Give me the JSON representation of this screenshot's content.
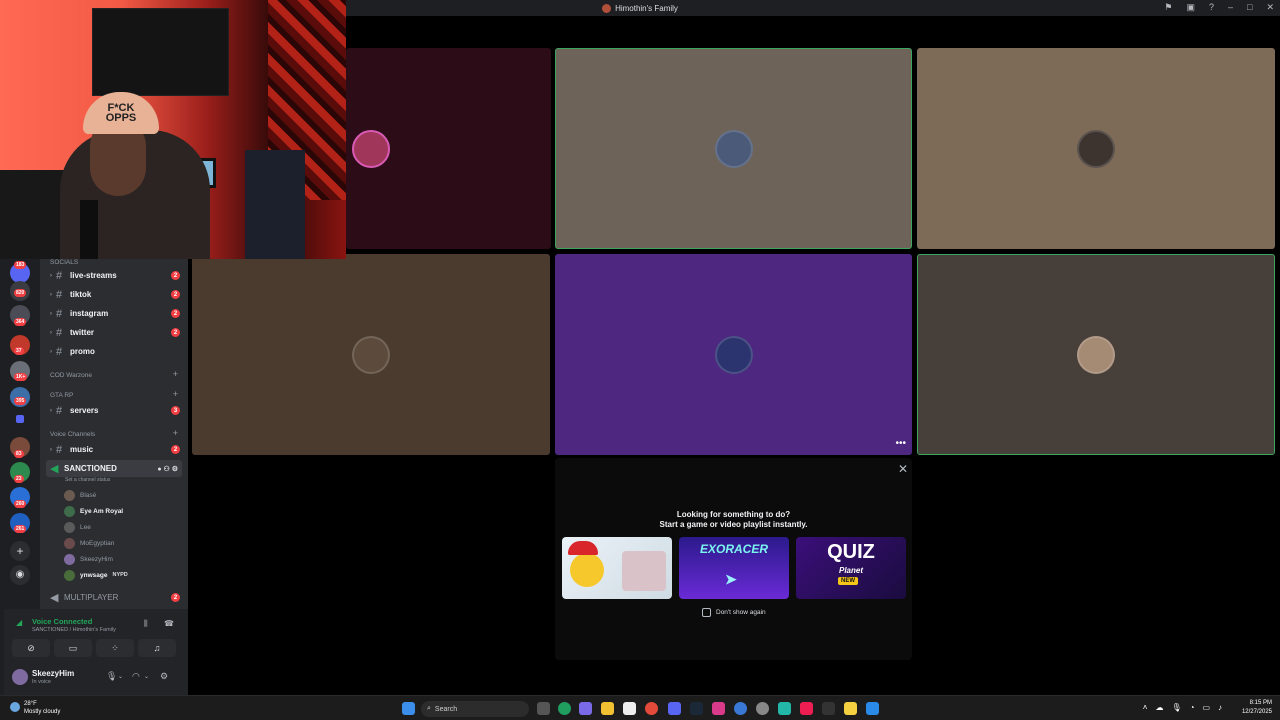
{
  "window": {
    "title": "Himothin's Family"
  },
  "channels": {
    "categories": [
      {
        "label": "SOCIALS",
        "top": 0
      },
      {
        "label": "COD Warzone"
      },
      {
        "label": "GTA RP"
      },
      {
        "label": "Voice Channels"
      }
    ],
    "text_channels": [
      {
        "name": "live-streams",
        "badge": "2"
      },
      {
        "name": "tiktok",
        "badge": "2"
      },
      {
        "name": "instagram",
        "badge": "2"
      },
      {
        "name": "twitter",
        "badge": "2"
      },
      {
        "name": "promo",
        "badge": ""
      },
      {
        "name": "servers",
        "badge": "3"
      },
      {
        "name": "music",
        "badge": "2"
      }
    ],
    "voice_channel": {
      "name": "SANCTIONED",
      "status": "Set a channel status"
    },
    "voice_users": [
      "Blasé",
      "Eye Am Royal",
      "Lee",
      "MoEgyptian",
      "SkeezyHim",
      "ynwsage"
    ],
    "voice_user_tag": "NYPD",
    "multiplayer": {
      "name": "MULTIPLAYER",
      "badge": "2"
    }
  },
  "rail_badges": [
    "183",
    "820",
    "364",
    "37",
    "1K+",
    "395",
    "83",
    "23",
    "260",
    "261"
  ],
  "voice_panel": {
    "status": "Voice Connected",
    "sub": "SANCTIONED / Himothin's Family"
  },
  "user": {
    "name": "SkeezyHim",
    "status": "In voice"
  },
  "activity": {
    "title": "Looking for something to do?",
    "subtitle": "Start a game or video playlist instantly.",
    "games": [
      {
        "name": "",
        "bg": "#e8eef3"
      },
      {
        "name": "EXORACER",
        "bg": "#4a1aa8"
      },
      {
        "name": "QUIZ",
        "sub": "Planet",
        "tag": "NEW",
        "bg": "#2a0d5a"
      }
    ],
    "dont_show": "Don't show again"
  },
  "taskbar": {
    "weather_temp": "28°F",
    "weather_desc": "Mostly cloudy",
    "search_placeholder": "Search",
    "time": "8:15 PM",
    "date": "12/27/2025"
  },
  "colors": {
    "speaking": "#3ba55d",
    "badge": "#f23f43",
    "connected": "#23a55a"
  }
}
